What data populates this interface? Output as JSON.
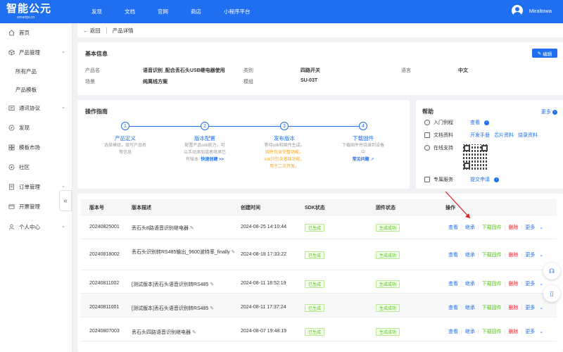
{
  "header": {
    "logo_text": "智能公元",
    "logo_sub": "smartpi.cn",
    "nav": [
      "发现",
      "文档",
      "官网",
      "商店",
      "小程序平台"
    ],
    "user_name": "Miraltowa"
  },
  "sidebar": {
    "items": [
      {
        "label": "首页",
        "icon": "home-icon"
      },
      {
        "label": "产品管理",
        "icon": "cube-icon"
      },
      {
        "label": "所有产品",
        "icon": ""
      },
      {
        "label": "产品模板",
        "icon": ""
      },
      {
        "label": "通讯协议",
        "icon": "protocol-icon"
      },
      {
        "label": "发现",
        "icon": "compass-icon"
      },
      {
        "label": "模板市场",
        "icon": "market-icon"
      },
      {
        "label": "社区",
        "icon": "community-icon"
      },
      {
        "label": "订单管理",
        "icon": "order-icon"
      },
      {
        "label": "开票管理",
        "icon": "invoice-icon"
      },
      {
        "label": "个人中心",
        "icon": "person-icon"
      }
    ]
  },
  "breadcrumb": {
    "back": "返回",
    "current": "产品详情"
  },
  "basic_info": {
    "title": "基本信息",
    "edit_label": "编辑",
    "fields": {
      "product_name_label": "产品名",
      "product_name_value": "语音识别_配合丢石头USB继电器使用",
      "category_label": "类别",
      "category_value": "四路开关",
      "language_label": "语言",
      "language_value": "中文",
      "scene_label": "场景",
      "scene_value": "纯离线方案",
      "module_label": "模组",
      "module_value": "SU-03T"
    }
  },
  "guide": {
    "title": "操作指南",
    "steps": [
      {
        "num": "1",
        "title": "产品定义",
        "desc1": "选择模组，填写产品名",
        "desc2": "等信息",
        "desc3": ""
      },
      {
        "num": "2",
        "title": "版本配置",
        "desc1": "配置产品sdk能力，可",
        "desc2": "以手动添加或者继承已",
        "desc3": "有版本"
      },
      {
        "num": "3",
        "title": "发布版本",
        "desc1": "等待sdk和固件生成。",
        "desc2": "固件包含完整功能，",
        "desc3": "sdk只包含基础功能，"
      },
      {
        "num": "4",
        "title": "下载固件",
        "desc1": "下载固件并烧录到设备",
        "desc2": "中",
        "desc3": ""
      }
    ],
    "quick_create": "快速创建 >>",
    "step3_extra": "用于二次开发。",
    "faq": "常见问题"
  },
  "help": {
    "title": "帮助",
    "more": "更多",
    "tutorial_label": "入门例程",
    "tutorial_link": "查看",
    "docs_label": "文档资料",
    "docs_links": [
      "开发手册",
      "芯片资料",
      "烧录资料"
    ],
    "support_label": "在线支持",
    "service_label": "专属服务",
    "service_link": "提交申请"
  },
  "table": {
    "headers": [
      "版本号",
      "版本描述",
      "创建时间",
      "SDK状态",
      "固件状态",
      "操作"
    ],
    "rows": [
      {
        "version": "20240825001",
        "desc": "丢石头8路语音识别继电器",
        "time": "2024-08-25 14:10:44",
        "sdk": "已生成",
        "firmware": "生成成功"
      },
      {
        "version": "20240818002",
        "desc": "丢石头识别转RS485输出_9600波特率_finally",
        "time": "2024-08-18 17:33:22",
        "sdk": "已生成",
        "firmware": "生成成功"
      },
      {
        "version": "20240811002",
        "desc": "[测试版本]丢石头语音识别转RS485",
        "time": "2024-08-11 18:52:19",
        "sdk": "已生成",
        "firmware": "生成成功"
      },
      {
        "version": "20240811001",
        "desc": "[测试版本]丢石头语音识别转RS485",
        "time": "2024-08-11 17:37:24",
        "sdk": "已生成",
        "firmware": "生成成功"
      },
      {
        "version": "20240807003",
        "desc": "丢石头四路语音识别继电器",
        "time": "2024-08-07 19:48:19",
        "sdk": "已生成",
        "firmware": "生成成功"
      }
    ],
    "actions": [
      "查看",
      "继承",
      "下载固件",
      "删除",
      "更多"
    ]
  },
  "colors": {
    "primary": "#1f6ff0",
    "success": "#52c41a",
    "danger": "#f5222d",
    "warning": "#f5a623"
  }
}
